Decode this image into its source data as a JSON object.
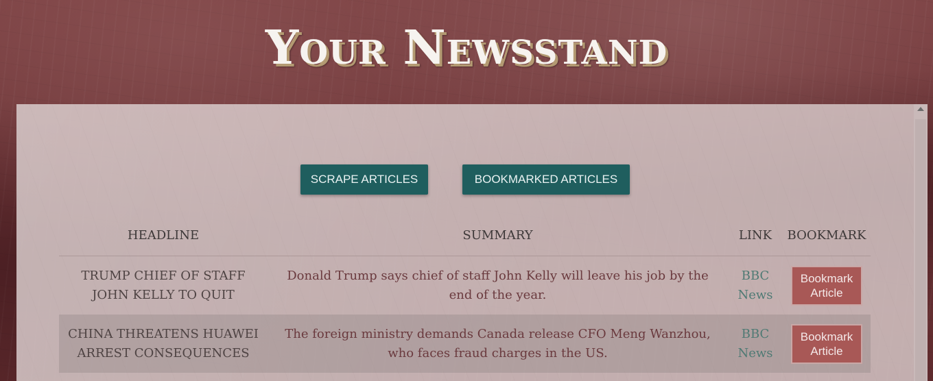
{
  "header": {
    "title": "Your Newsstand"
  },
  "toolbar": {
    "scrape_label": "SCRAPE ARTICLES",
    "bookmarked_label": "BOOKMARKED ARTICLES"
  },
  "table": {
    "columns": [
      "HEADLINE",
      "SUMMARY",
      "LINK",
      "BOOKMARK"
    ],
    "rows": [
      {
        "headline_line1": "TRUMP CHIEF OF STAFF",
        "headline_line2": "JOHN KELLY TO QUIT",
        "summary_line1": "Donald Trump says chief of staff John Kelly will leave his job by the",
        "summary_line2": "end of the year.",
        "link_line1": "BBC",
        "link_line2": "News",
        "bookmark_line1": "Bookmark",
        "bookmark_line2": "Article"
      },
      {
        "headline_line1": "CHINA THREATENS HUAWEI",
        "headline_line2": "ARREST CONSEQUENCES",
        "summary_line1": "The foreign ministry demands Canada release CFO Meng Wanzhou,",
        "summary_line2": "who faces fraud charges in the US.",
        "link_line1": "BBC",
        "link_line2": "News",
        "bookmark_line1": "Bookmark",
        "bookmark_line2": "Article"
      }
    ]
  },
  "colors": {
    "background": "#6a3032",
    "button": "#1f5e5e",
    "bookmark_button": "#a85856",
    "link": "#4f7a74"
  }
}
